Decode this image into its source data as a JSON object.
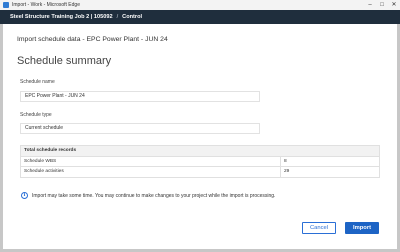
{
  "window": {
    "title": "Import - Work - Microsoft Edge",
    "controls": {
      "minimize": "–",
      "maximize": "□",
      "close": "✕"
    }
  },
  "appbar": {
    "project": "Steel Structure Training Job 2 | 105092",
    "separator": "/",
    "section": "Control"
  },
  "dialog": {
    "subheader": "Import schedule data - EPC Power Plant - JUN 24",
    "title": "Schedule summary",
    "schedule_name": {
      "label": "Schedule name",
      "value": "EPC Power Plant - JUN 24"
    },
    "schedule_type": {
      "label": "Schedule type",
      "value": "Current schedule"
    },
    "records_table": {
      "header": "Total schedule records",
      "rows": [
        {
          "label": "Schedule WBS",
          "value": "8"
        },
        {
          "label": "Schedule activities",
          "value": "29"
        }
      ]
    },
    "info_icon": "i",
    "info_text": "Import may take some time. You may continue to make changes to your project while the import is processing.",
    "buttons": {
      "cancel": "Cancel",
      "import": "Import"
    }
  },
  "colors": {
    "appbar_bg": "#1f2e3d",
    "accent": "#1d64c5",
    "table_header_bg": "#f2f2f2"
  },
  "icons": {
    "app": "browser-app-icon",
    "info": "info-icon"
  }
}
